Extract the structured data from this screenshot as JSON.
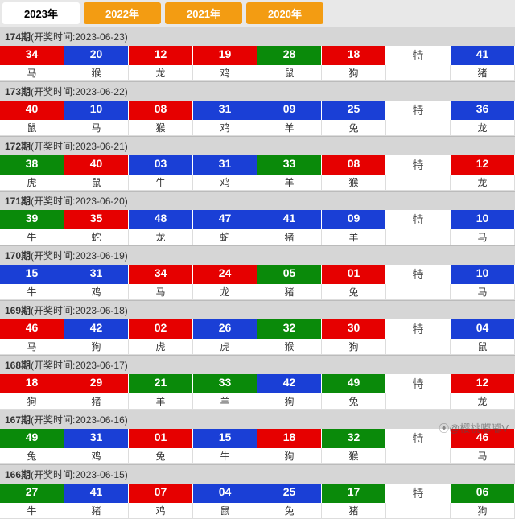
{
  "tabs": [
    {
      "label": "2023年",
      "active": true
    },
    {
      "label": "2022年",
      "active": false
    },
    {
      "label": "2021年",
      "active": false
    },
    {
      "label": "2020年",
      "active": false
    }
  ],
  "te": "特",
  "watermark": "⦿@樱桃嘟嘟V",
  "periods": [
    {
      "num": "174",
      "date": "2023-06-23",
      "balls": [
        {
          "n": "34",
          "z": "马",
          "c": "red"
        },
        {
          "n": "20",
          "z": "猴",
          "c": "blue"
        },
        {
          "n": "12",
          "z": "龙",
          "c": "red"
        },
        {
          "n": "19",
          "z": "鸡",
          "c": "red"
        },
        {
          "n": "28",
          "z": "鼠",
          "c": "green"
        },
        {
          "n": "18",
          "z": "狗",
          "c": "red"
        }
      ],
      "special": {
        "n": "41",
        "z": "猪",
        "c": "blue"
      }
    },
    {
      "num": "173",
      "date": "2023-06-22",
      "balls": [
        {
          "n": "40",
          "z": "鼠",
          "c": "red"
        },
        {
          "n": "10",
          "z": "马",
          "c": "blue"
        },
        {
          "n": "08",
          "z": "猴",
          "c": "red"
        },
        {
          "n": "31",
          "z": "鸡",
          "c": "blue"
        },
        {
          "n": "09",
          "z": "羊",
          "c": "blue"
        },
        {
          "n": "25",
          "z": "兔",
          "c": "blue"
        }
      ],
      "special": {
        "n": "36",
        "z": "龙",
        "c": "blue"
      }
    },
    {
      "num": "172",
      "date": "2023-06-21",
      "balls": [
        {
          "n": "38",
          "z": "虎",
          "c": "green"
        },
        {
          "n": "40",
          "z": "鼠",
          "c": "red"
        },
        {
          "n": "03",
          "z": "牛",
          "c": "blue"
        },
        {
          "n": "31",
          "z": "鸡",
          "c": "blue"
        },
        {
          "n": "33",
          "z": "羊",
          "c": "green"
        },
        {
          "n": "08",
          "z": "猴",
          "c": "red"
        }
      ],
      "special": {
        "n": "12",
        "z": "龙",
        "c": "red"
      }
    },
    {
      "num": "171",
      "date": "2023-06-20",
      "balls": [
        {
          "n": "39",
          "z": "牛",
          "c": "green"
        },
        {
          "n": "35",
          "z": "蛇",
          "c": "red"
        },
        {
          "n": "48",
          "z": "龙",
          "c": "blue"
        },
        {
          "n": "47",
          "z": "蛇",
          "c": "blue"
        },
        {
          "n": "41",
          "z": "猪",
          "c": "blue"
        },
        {
          "n": "09",
          "z": "羊",
          "c": "blue"
        }
      ],
      "special": {
        "n": "10",
        "z": "马",
        "c": "blue"
      }
    },
    {
      "num": "170",
      "date": "2023-06-19",
      "balls": [
        {
          "n": "15",
          "z": "牛",
          "c": "blue"
        },
        {
          "n": "31",
          "z": "鸡",
          "c": "blue"
        },
        {
          "n": "34",
          "z": "马",
          "c": "red"
        },
        {
          "n": "24",
          "z": "龙",
          "c": "red"
        },
        {
          "n": "05",
          "z": "猪",
          "c": "green"
        },
        {
          "n": "01",
          "z": "兔",
          "c": "red"
        }
      ],
      "special": {
        "n": "10",
        "z": "马",
        "c": "blue"
      }
    },
    {
      "num": "169",
      "date": "2023-06-18",
      "balls": [
        {
          "n": "46",
          "z": "马",
          "c": "red"
        },
        {
          "n": "42",
          "z": "狗",
          "c": "blue"
        },
        {
          "n": "02",
          "z": "虎",
          "c": "red"
        },
        {
          "n": "26",
          "z": "虎",
          "c": "blue"
        },
        {
          "n": "32",
          "z": "猴",
          "c": "green"
        },
        {
          "n": "30",
          "z": "狗",
          "c": "red"
        }
      ],
      "special": {
        "n": "04",
        "z": "鼠",
        "c": "blue"
      }
    },
    {
      "num": "168",
      "date": "2023-06-17",
      "balls": [
        {
          "n": "18",
          "z": "狗",
          "c": "red"
        },
        {
          "n": "29",
          "z": "猪",
          "c": "red"
        },
        {
          "n": "21",
          "z": "羊",
          "c": "green"
        },
        {
          "n": "33",
          "z": "羊",
          "c": "green"
        },
        {
          "n": "42",
          "z": "狗",
          "c": "blue"
        },
        {
          "n": "49",
          "z": "兔",
          "c": "green"
        }
      ],
      "special": {
        "n": "12",
        "z": "龙",
        "c": "red"
      }
    },
    {
      "num": "167",
      "date": "2023-06-16",
      "balls": [
        {
          "n": "49",
          "z": "兔",
          "c": "green"
        },
        {
          "n": "31",
          "z": "鸡",
          "c": "blue"
        },
        {
          "n": "01",
          "z": "兔",
          "c": "red"
        },
        {
          "n": "15",
          "z": "牛",
          "c": "blue"
        },
        {
          "n": "18",
          "z": "狗",
          "c": "red"
        },
        {
          "n": "32",
          "z": "猴",
          "c": "green"
        }
      ],
      "special": {
        "n": "46",
        "z": "马",
        "c": "red"
      }
    },
    {
      "num": "166",
      "date": "2023-06-15",
      "balls": [
        {
          "n": "27",
          "z": "牛",
          "c": "green"
        },
        {
          "n": "41",
          "z": "猪",
          "c": "blue"
        },
        {
          "n": "07",
          "z": "鸡",
          "c": "red"
        },
        {
          "n": "04",
          "z": "鼠",
          "c": "blue"
        },
        {
          "n": "25",
          "z": "兔",
          "c": "blue"
        },
        {
          "n": "17",
          "z": "猪",
          "c": "green"
        }
      ],
      "special": {
        "n": "06",
        "z": "狗",
        "c": "green"
      }
    }
  ]
}
